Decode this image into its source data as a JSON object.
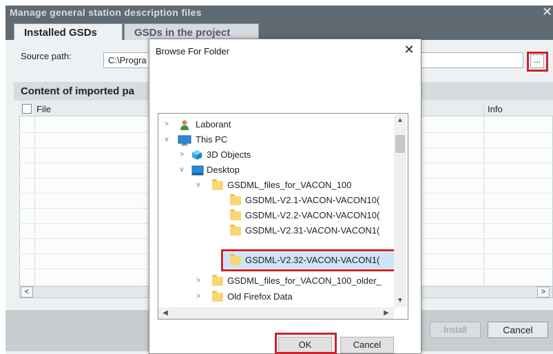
{
  "colors": {
    "title_bar": "#5f6a72",
    "highlight": "#d0202a",
    "selection": "#cce4f7",
    "folder": "#f8d775"
  },
  "main_dialog": {
    "title": "Manage general station description files",
    "close_glyph": "✕",
    "tabs": [
      {
        "label": "Installed GSDs"
      },
      {
        "label": "GSDs in the project"
      }
    ],
    "source_path": {
      "label": "Source path:",
      "value": "C:\\Progra",
      "browse_label": "..."
    },
    "content_title": "Content of imported pa",
    "table": {
      "col_file": "File",
      "col_info": "Info"
    },
    "scroll_left": "<",
    "scroll_right": ">",
    "install_label": "Install",
    "cancel_label": "Cancel"
  },
  "browse_dialog": {
    "title": "Browse For Folder",
    "close_glyph": "✕",
    "tree": [
      {
        "label": "Laborant",
        "icon": "user-icon",
        "chevron": ">"
      },
      {
        "label": "This PC",
        "icon": "computer-icon",
        "chevron": "v"
      },
      {
        "label": "3D Objects",
        "icon": "3d-objects-icon",
        "chevron": ">"
      },
      {
        "label": "Desktop",
        "icon": "desktop-icon",
        "chevron": "v"
      },
      {
        "label": "GSDML_files_for_VACON_100",
        "icon": "folder-icon",
        "chevron": "v"
      },
      {
        "label": "GSDML-V2.1-VACON-VACON10(",
        "icon": "folder-icon",
        "chevron": ""
      },
      {
        "label": "GSDML-V2.2-VACON-VACON10(",
        "icon": "folder-icon",
        "chevron": ""
      },
      {
        "label": "GSDML-V2.31-VACON-VACON1(",
        "icon": "folder-icon",
        "chevron": ""
      },
      {
        "label": "GSDML-V2.32-VACON-VACON1(",
        "icon": "folder-icon",
        "chevron": "",
        "selected": true
      },
      {
        "label": "GSDML_files_for_VACON_100_older_",
        "icon": "folder-icon",
        "chevron": ">"
      },
      {
        "label": "Old Firefox Data",
        "icon": "folder-icon",
        "chevron": ">"
      }
    ],
    "ok_label": "OK",
    "cancel_label": "Cancel"
  }
}
